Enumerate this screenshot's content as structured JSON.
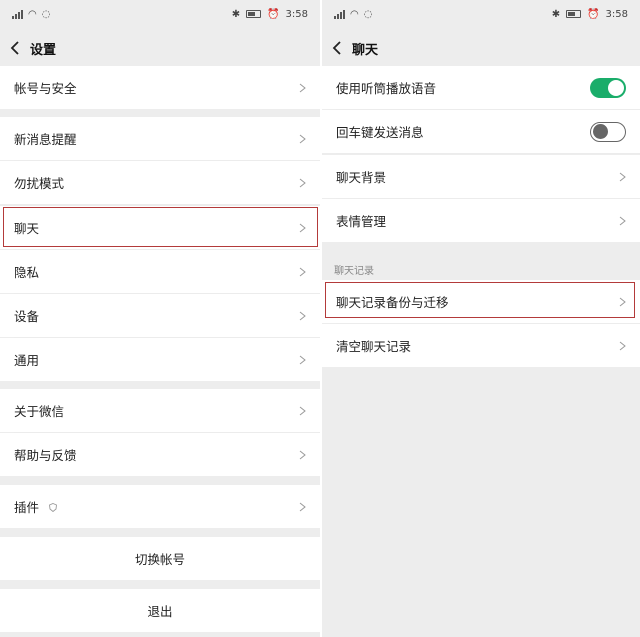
{
  "status": {
    "left_text": "⁴",
    "time": "3:58"
  },
  "left": {
    "title": "设置",
    "items": {
      "account": "帐号与安全",
      "notifications": "新消息提醒",
      "dnd": "勿扰模式",
      "chat": "聊天",
      "privacy": "隐私",
      "devices": "设备",
      "general": "通用",
      "about": "关于微信",
      "help": "帮助与反馈",
      "plugins": "插件"
    },
    "switch_account": "切换帐号",
    "logout": "退出"
  },
  "right": {
    "title": "聊天",
    "items": {
      "earpiece": "使用听筒播放语音",
      "enter_send": "回车键发送消息",
      "background": "聊天背景",
      "stickers": "表情管理",
      "backup": "聊天记录备份与迁移",
      "clear": "清空聊天记录"
    },
    "section_history": "聊天记录",
    "toggles": {
      "earpiece_on": true,
      "enter_send_on": false
    }
  },
  "colors": {
    "accent_green": "#1aad6a",
    "highlight_red": "#b33a3a",
    "page_bg": "#ededed"
  }
}
